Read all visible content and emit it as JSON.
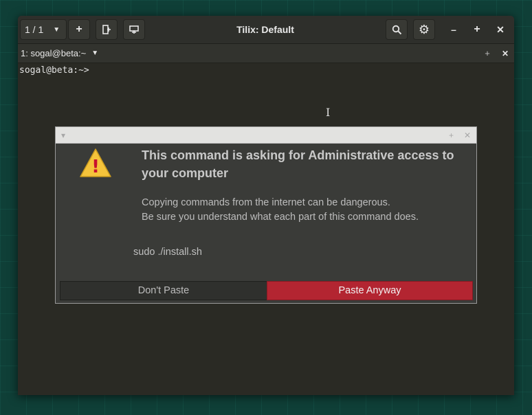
{
  "window": {
    "title": "Tilix: Default",
    "session_count": "1 / 1",
    "icons": {
      "session_menu": "triangle-down-icon",
      "add_session": "plus-icon",
      "new_terminal_right": "split-right-icon",
      "new_terminal_down": "split-down-icon",
      "search": "search-icon",
      "settings": "gear-icon",
      "minimize": "minimize-icon",
      "maximize": "maximize-icon",
      "close": "close-icon"
    },
    "glyphs": {
      "session_menu": "▼",
      "add_session": "+",
      "search": "⚲",
      "settings": "⚙",
      "minimize": "–",
      "maximize": "+",
      "close": "✕"
    }
  },
  "tab": {
    "label": "1: sogal@beta:~",
    "menu_glyph": "▼",
    "add_glyph": "+",
    "close_glyph": "✕"
  },
  "terminal": {
    "prompt": "sogal@beta:~>",
    "cursor_glyph": "I"
  },
  "dialog": {
    "titlebar_glyphs": {
      "menu": "▾",
      "maximize": "+",
      "close": "✕"
    },
    "heading": "This command is asking for Administrative access to your computer",
    "body_line1": "Copying commands from the internet can be dangerous.",
    "body_line2": "Be sure you understand what each part of this command does.",
    "command": "sudo ./install.sh",
    "button_dont": "Don't Paste",
    "button_paste": "Paste Anyway",
    "warning_glyph": "!",
    "colors": {
      "warning_fill": "#f5c33b",
      "paste_button": "#b32531"
    }
  }
}
